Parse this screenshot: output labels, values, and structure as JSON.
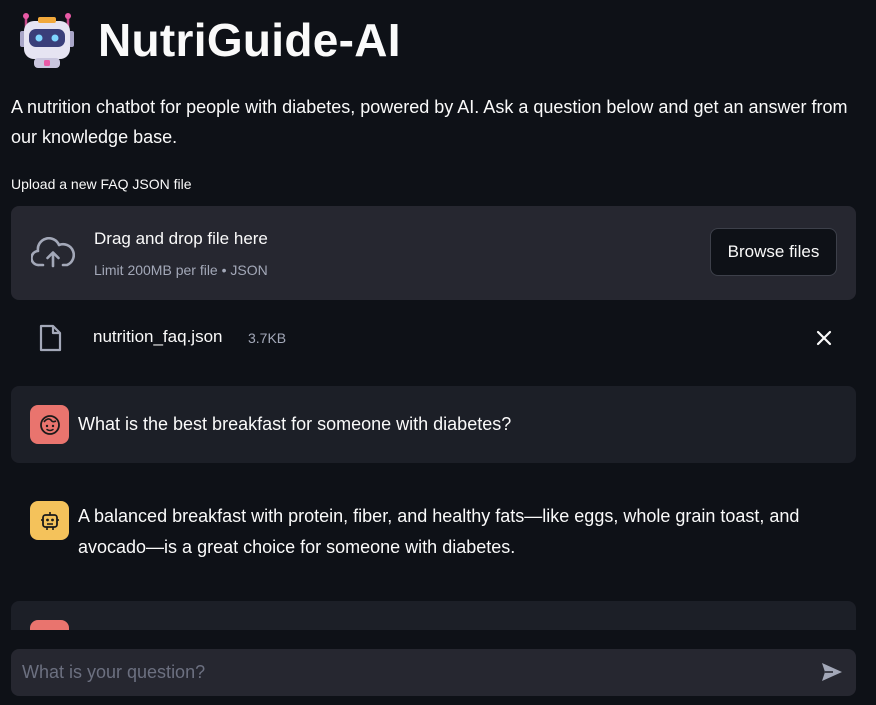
{
  "header": {
    "title": "NutriGuide-AI",
    "logo_icon": "robot-face-icon"
  },
  "intro_text": "A nutrition chatbot for people with diabetes, powered by AI. Ask a question below and get an answer from our knowledge base.",
  "uploader": {
    "label": "Upload a new FAQ JSON file",
    "drop_title": "Drag and drop file here",
    "drop_subtitle": "Limit 200MB per file • JSON",
    "browse_label": "Browse files",
    "file_name": "nutrition_faq.json",
    "file_size": "3.7KB"
  },
  "chat": {
    "messages": [
      {
        "role": "user",
        "text": "What is the best breakfast for someone with diabetes?"
      },
      {
        "role": "assistant",
        "text": "A balanced breakfast with protein, fiber, and healthy fats—like eggs, whole grain toast, and avocado—is a great choice for someone with diabetes."
      },
      {
        "role": "user",
        "text": ""
      }
    ]
  },
  "input": {
    "placeholder": "What is your question?",
    "value": ""
  },
  "colors": {
    "background": "#0e1117",
    "surface": "#262730",
    "user_avatar": "#e9746e",
    "assistant_avatar": "#f4c25b"
  }
}
